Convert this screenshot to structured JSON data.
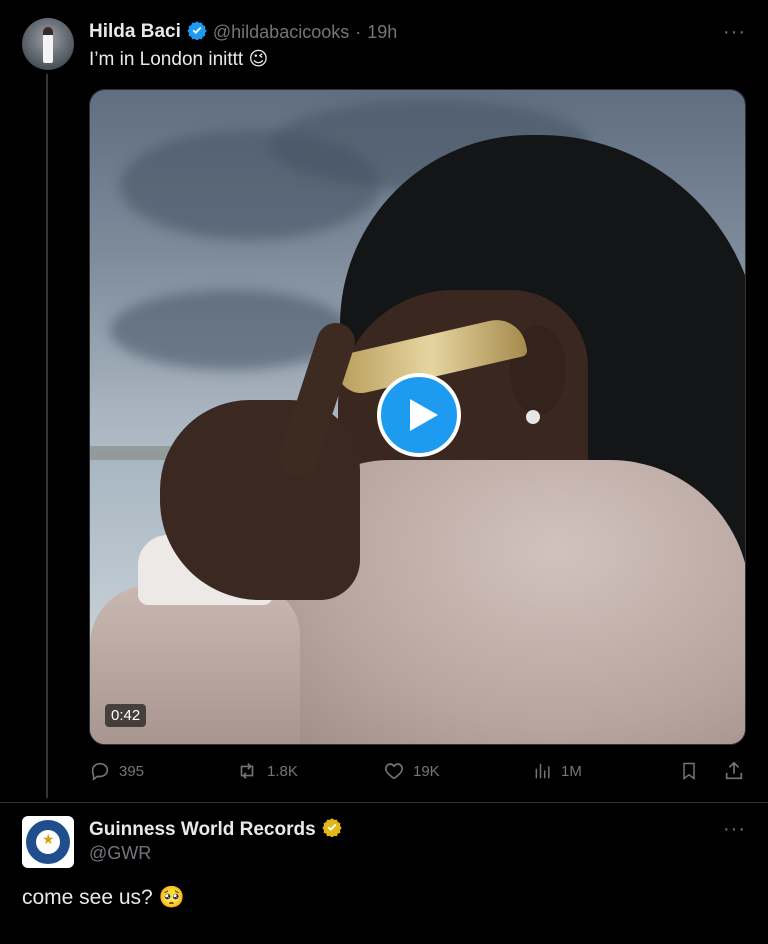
{
  "tweet1": {
    "display_name": "Hilda Baci",
    "handle": "@hildabacicooks",
    "separator": "·",
    "time": "19h",
    "text": "I’m in London inittt",
    "emoji": "😉",
    "verified_color": "#1d9bf0",
    "video": {
      "duration": "0:42"
    },
    "actions": {
      "replies": "395",
      "reposts": "1.8K",
      "likes": "19K",
      "views": "1M"
    }
  },
  "tweet2": {
    "display_name": "Guinness World Records",
    "handle": "@GWR",
    "text": "come see us?",
    "emoji": "🥺",
    "verified_color": "#e2b719"
  },
  "more_label": "···",
  "colors": {
    "background": "#000000",
    "text": "#e7e9ea",
    "muted": "#71767b",
    "accent": "#1d9bf0"
  }
}
